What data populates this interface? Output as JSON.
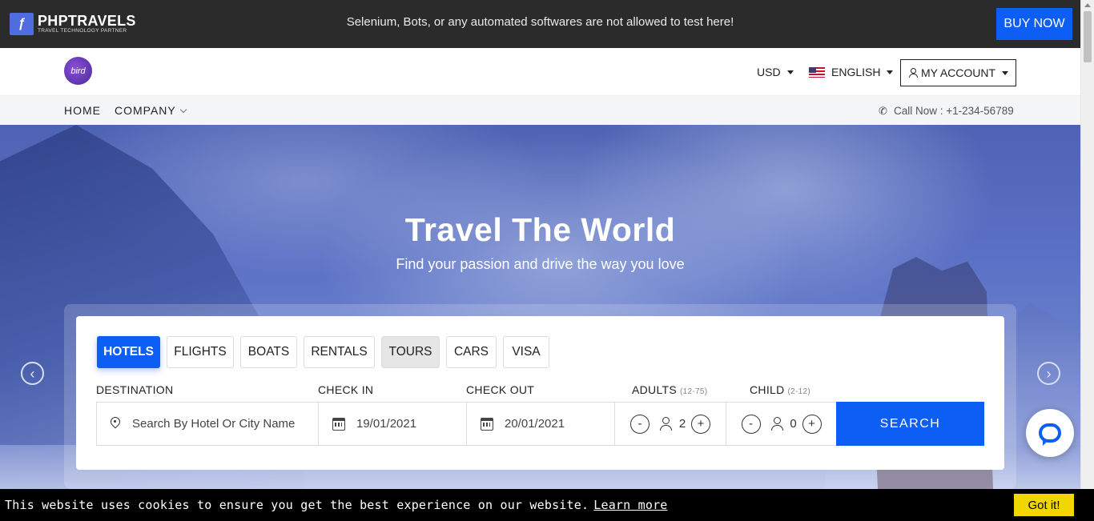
{
  "topbar": {
    "brand_name": "PHPTRAVELS",
    "brand_tagline": "TRAVEL TECHNOLOGY PARTNER",
    "logo_glyph": "ƒ",
    "message": "Selenium, Bots, or any automated softwares are not allowed to test here!",
    "buy_now_label": "BUY NOW",
    "background_color": "#2b2b2b",
    "accent_color": "#0d5ef4"
  },
  "header": {
    "logo_text": "bird",
    "currency": "USD",
    "language": "ENGLISH",
    "account_label": "MY ACCOUNT"
  },
  "nav": {
    "items": [
      {
        "label": "HOME",
        "has_dropdown": false
      },
      {
        "label": "COMPANY",
        "has_dropdown": true
      }
    ],
    "call_label": "Call Now : +1-234-56789",
    "call_icon": "phone-icon"
  },
  "hero": {
    "title": "Travel The World",
    "subtitle": "Find your passion and drive the way you love",
    "prev_icon": "chevron-left-icon",
    "next_icon": "chevron-right-icon",
    "prev_glyph": "‹",
    "next_glyph": "›"
  },
  "search": {
    "tabs": [
      {
        "label": "HOTELS",
        "state": "active"
      },
      {
        "label": "FLIGHTS",
        "state": "normal"
      },
      {
        "label": "BOATS",
        "state": "normal"
      },
      {
        "label": "RENTALS",
        "state": "normal"
      },
      {
        "label": "TOURS",
        "state": "hover"
      },
      {
        "label": "CARS",
        "state": "normal"
      },
      {
        "label": "VISA",
        "state": "normal"
      }
    ],
    "labels": {
      "destination": "DESTINATION",
      "check_in": "CHECK IN",
      "check_out": "CHECK OUT",
      "adults": "ADULTS",
      "adults_range": "(12-75)",
      "child": "CHILD",
      "child_range": "(2-12)"
    },
    "destination_placeholder": "Search By Hotel Or City Name",
    "check_in_value": "19/01/2021",
    "check_out_value": "20/01/2021",
    "adults_value": "2",
    "child_value": "0",
    "minus_glyph": "-",
    "plus_glyph": "+",
    "search_label": "SEARCH"
  },
  "cookie": {
    "message": "This website uses cookies to ensure you get the best experience on our website.",
    "link_label": "Learn more",
    "button_label": "Got it!",
    "button_color": "#f1d600"
  }
}
